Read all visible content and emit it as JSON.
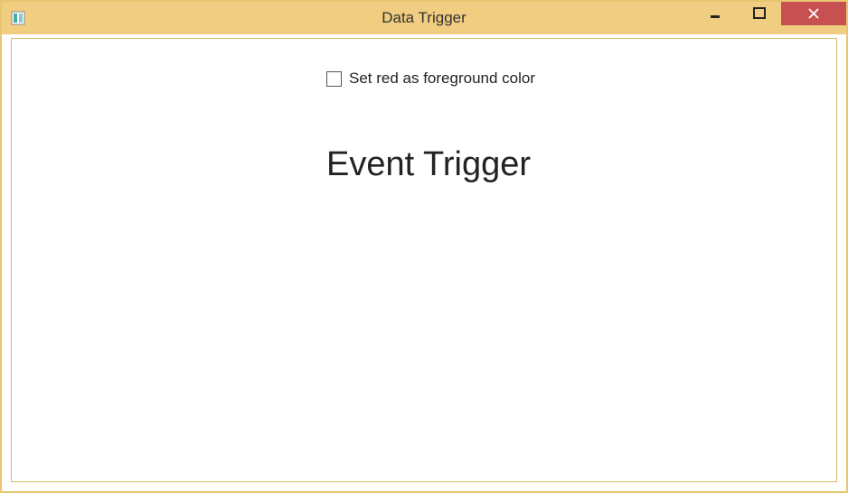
{
  "window": {
    "title": "Data Trigger"
  },
  "content": {
    "checkbox_label": "Set red as foreground color",
    "heading": "Event Trigger"
  }
}
